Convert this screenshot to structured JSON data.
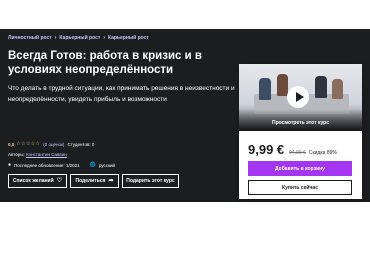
{
  "breadcrumb": [
    "Личностный рост",
    "Карьерный рост",
    "Карьерный рост"
  ],
  "course": {
    "title": "Всегда Готов: работа в кризис и в условиях неопределённости",
    "subtitle": "Что делать в трудной ситуации, как принимать решения в неизвестности и неопределённости, увидеть прибыль и возможности",
    "rating_value": "0,0",
    "stars": "☆☆☆☆☆",
    "ratings_text": "(0 оценок)",
    "students_text": "Студентов: 0",
    "authors_label": "Авторы:",
    "author_name": "Константин Саввин",
    "updated_text": "Последнее обновление: 1/2021",
    "language": "русский"
  },
  "actions": {
    "wishlist_label": "Список желаний",
    "share_label": "Поделиться",
    "gift_label": "Подарить этот курс"
  },
  "card": {
    "preview_label": "Просмотреть этот курс",
    "price": "9,99 €",
    "old_price": "94,99 €",
    "discount": "Скидка 89%",
    "cart_label": "Добавить в корзину",
    "buy_label": "Купить сейчас"
  },
  "colors": {
    "hero_background": "#1c1d1f",
    "accent_link": "#cec0fc",
    "rating_gold": "#f3ca8c",
    "cart_button": "#a435f0"
  },
  "icons": {
    "wishlist": "heart-icon",
    "share": "share-icon",
    "play": "play-icon",
    "updated": "alert-icon",
    "language": "globe-icon"
  }
}
